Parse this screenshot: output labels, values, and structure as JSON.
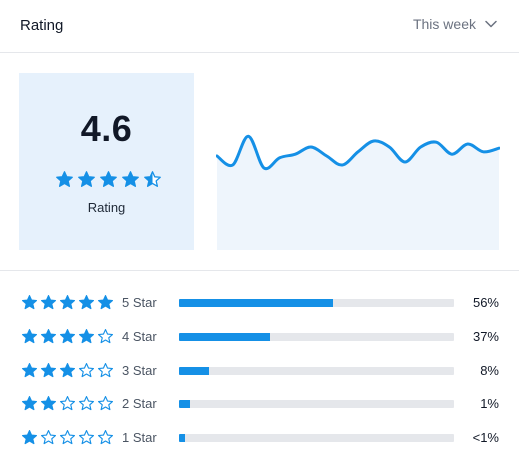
{
  "header": {
    "title": "Rating",
    "period": "This week"
  },
  "summary": {
    "score": "4.6",
    "caption": "Rating",
    "stars": [
      "full",
      "full",
      "full",
      "full",
      "half"
    ]
  },
  "trend": {
    "values": [
      0.55,
      0.4,
      0.88,
      0.35,
      0.52,
      0.58,
      0.7,
      0.55,
      0.4,
      0.62,
      0.8,
      0.7,
      0.45,
      0.7,
      0.78,
      0.58,
      0.75,
      0.62,
      0.68
    ]
  },
  "breakdown": [
    {
      "label": "5 Star",
      "stars": 5,
      "percent_text": "56%",
      "fill": 0.56
    },
    {
      "label": "4 Star",
      "stars": 4,
      "percent_text": "37%",
      "fill": 0.33
    },
    {
      "label": "3 Star",
      "stars": 3,
      "percent_text": "8%",
      "fill": 0.11
    },
    {
      "label": "2 Star",
      "stars": 2,
      "percent_text": "1%",
      "fill": 0.04
    },
    {
      "label": "1 Star",
      "stars": 1,
      "percent_text": "<1%",
      "fill": 0.02
    }
  ],
  "colors": {
    "accent": "#1590e6",
    "panel": "#e6f1fc",
    "chart_fill": "#eef5fc",
    "track": "#e5e7eb"
  }
}
